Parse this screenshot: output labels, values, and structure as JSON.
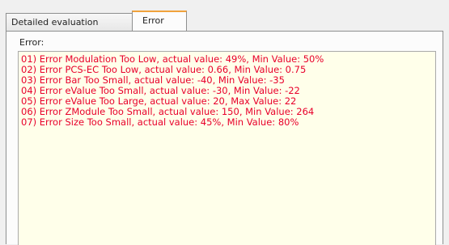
{
  "tabs": [
    {
      "label": "Detailed evaluation",
      "active": false
    },
    {
      "label": "Error",
      "active": true
    }
  ],
  "error_panel": {
    "label": "Error:",
    "lines": [
      "01) Error  Modulation Too Low, actual value: 49%, Min Value: 50%",
      "02) Error  PCS-EC Too Low, actual value: 0.66, Min Value: 0.75",
      "03) Error  Bar Too Small, actual value: -40, Min Value: -35",
      "04) Error  eValue Too Small, actual value: -30, Min Value: -22",
      "05) Error  eValue Too Large, actual value: 20, Max Value: 22",
      "06) Error  ZModule Too Small, actual value: 150, Min Value: 264",
      "07) Error  Size Too Small, actual value: 45%, Min Value: 80%"
    ]
  },
  "colors": {
    "error_text": "#e8002a",
    "error_background": "#ffffea",
    "active_tab_accent": "#f0a23c"
  }
}
